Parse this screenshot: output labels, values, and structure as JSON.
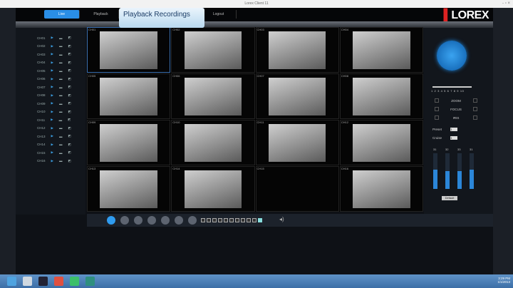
{
  "window": {
    "title": "Lorex Client 11",
    "controls": "- ▫ ×"
  },
  "nav": {
    "tabs": [
      "Live",
      "Playback",
      "",
      "Logout"
    ],
    "active": 0,
    "tooltip": "Playback Recordings",
    "logo": "LOREX"
  },
  "channels": [
    "CH01",
    "CH02",
    "CH03",
    "CH04",
    "CH05",
    "CH06",
    "CH07",
    "CH08",
    "CH09",
    "CH10",
    "CH11",
    "CH12",
    "CH13",
    "CH14",
    "CH15",
    "CH16"
  ],
  "tiles": [
    {
      "label": "CH01",
      "feed": true
    },
    {
      "label": "CH02",
      "feed": true
    },
    {
      "label": "CH03",
      "feed": true
    },
    {
      "label": "CH04",
      "feed": true
    },
    {
      "label": "CH05",
      "feed": true
    },
    {
      "label": "CH06",
      "feed": true
    },
    {
      "label": "CH07",
      "feed": true
    },
    {
      "label": "CH08",
      "feed": true
    },
    {
      "label": "CH09",
      "feed": true
    },
    {
      "label": "CH10",
      "feed": true
    },
    {
      "label": "CH11",
      "feed": true
    },
    {
      "label": "CH12",
      "feed": true
    },
    {
      "label": "CH13",
      "feed": true
    },
    {
      "label": "CH14",
      "feed": true
    },
    {
      "label": "CH15",
      "feed": false
    },
    {
      "label": "CH16",
      "feed": true
    }
  ],
  "ptz": {
    "speed_ticks": "1 2 3 4 5 6 7 8 9 10",
    "speed": 0.5,
    "rows": [
      "ZOOM",
      "FOCUS",
      "IRIS"
    ],
    "preset": "Preset",
    "cruise": "Cruise",
    "preset_value": "1",
    "cruise_value": "1",
    "color_bars": [
      {
        "label": "31",
        "level": 0.55
      },
      {
        "label": "32",
        "level": 0.5
      },
      {
        "label": "33",
        "level": 0.5
      },
      {
        "label": "31",
        "level": 0.55
      }
    ],
    "default": "Default"
  },
  "toolbar": {
    "icons": [
      "fullscreen-icon",
      "record-icon",
      "snapshot-icon",
      "refresh-icon",
      "settings-icon",
      "search-icon",
      "user-icon"
    ],
    "layouts": 11,
    "active_layout": 10,
    "volume_icon": "speaker-icon"
  },
  "taskbar": {
    "apps": [
      "ie-icon",
      "explorer-icon",
      "store-icon",
      "media-icon",
      "app-icon",
      "lorex-icon"
    ],
    "time": "3:29 PM",
    "date": "1/1/2013"
  },
  "colors": {
    "accent": "#2a8ee6",
    "taskbar": "#4a7fb8",
    "logo_red": "#dd2222"
  }
}
